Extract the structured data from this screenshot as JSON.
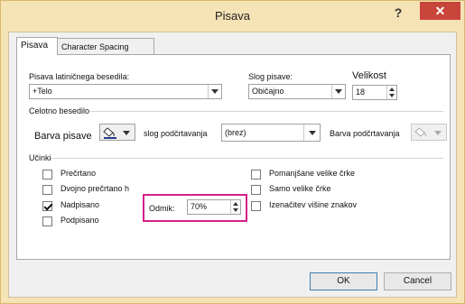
{
  "window": {
    "title": "Pisava",
    "help_label": "?",
    "close_label": "✕"
  },
  "tabs": [
    {
      "label": "Pisava"
    },
    {
      "label": "Character Spacing"
    }
  ],
  "font": {
    "latin_label": "Pisava latiničnega besedila:",
    "latin_value": "+Telo",
    "style_label": "Slog pisave:",
    "style_value": "Običajno",
    "size_label": "Velikost",
    "size_value": "18"
  },
  "all_text": {
    "group_label": "Celotno besedilo",
    "font_color_label": "Barva pisave",
    "underline_style_label": "slog podčrtavanja",
    "underline_style_value": "(brez)",
    "underline_color_label": "Barva podčrtavanja",
    "font_color_icon": "paint-bucket-icon",
    "underline_color_icon": "paint-bucket-icon"
  },
  "effects": {
    "group_label": "Učinki",
    "left": [
      {
        "label": "Prečrtano",
        "checked": false
      },
      {
        "label": "Dvojno prečrtano h",
        "checked": false
      },
      {
        "label": "Nadpisano",
        "checked": true
      },
      {
        "label": "Podpisano",
        "checked": false
      }
    ],
    "right": [
      {
        "label": "Pomanjšane velike črke",
        "checked": false
      },
      {
        "label": "Samo velike črke",
        "checked": false
      },
      {
        "label": "Izenačitev višine znakov",
        "checked": false
      }
    ],
    "offset_label": "Odmik:",
    "offset_value": "70%",
    "highlight_color": "#d4208a"
  },
  "buttons": {
    "ok": "OK",
    "cancel": "Cancel"
  },
  "colors": {
    "title_bar": "#f6e3b5",
    "close": "#c8453a"
  }
}
